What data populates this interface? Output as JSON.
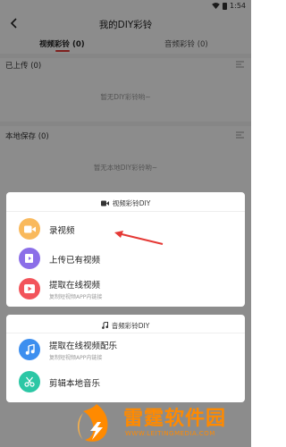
{
  "status_bar": {
    "time": "1:54"
  },
  "header": {
    "title": "我的DIY彩铃"
  },
  "tabs": [
    {
      "label": "视频彩铃 (0)",
      "active": true
    },
    {
      "label": "音频彩铃 (0)",
      "active": false
    }
  ],
  "sections": {
    "uploaded": {
      "title": "已上传 (0)",
      "empty": "暂无DIY彩铃哟~"
    },
    "local": {
      "title": "本地保存 (0)",
      "empty": "暂无本地DIY彩铃哟~"
    }
  },
  "video_sheet": {
    "title": "视频彩铃DIY",
    "items": [
      {
        "label": "录视频",
        "icon": "video-camera-icon",
        "color": "#f9b95c"
      },
      {
        "label": "上传已有视频",
        "icon": "upload-video-icon",
        "color": "#8b6ee8"
      },
      {
        "label": "提取在线视频",
        "sub": "复制短视频APP内链接",
        "icon": "play-video-icon",
        "color": "#f2545b"
      }
    ]
  },
  "audio_sheet": {
    "title": "音频彩铃DIY",
    "items": [
      {
        "label": "提取在线视频配乐",
        "sub": "复制短视频APP内链接",
        "icon": "music-note-icon",
        "color": "#3d8fef"
      },
      {
        "label": "剪辑本地音乐",
        "icon": "scissors-icon",
        "color": "#2cc7a5"
      }
    ]
  },
  "watermark": {
    "name": "雷霆软件园",
    "url": "WWW.LEITINGMEDIA.COM"
  },
  "colors": {
    "accent": "#e53935",
    "annotation_arrow": "#e53935",
    "watermark": "#ff8a00"
  }
}
